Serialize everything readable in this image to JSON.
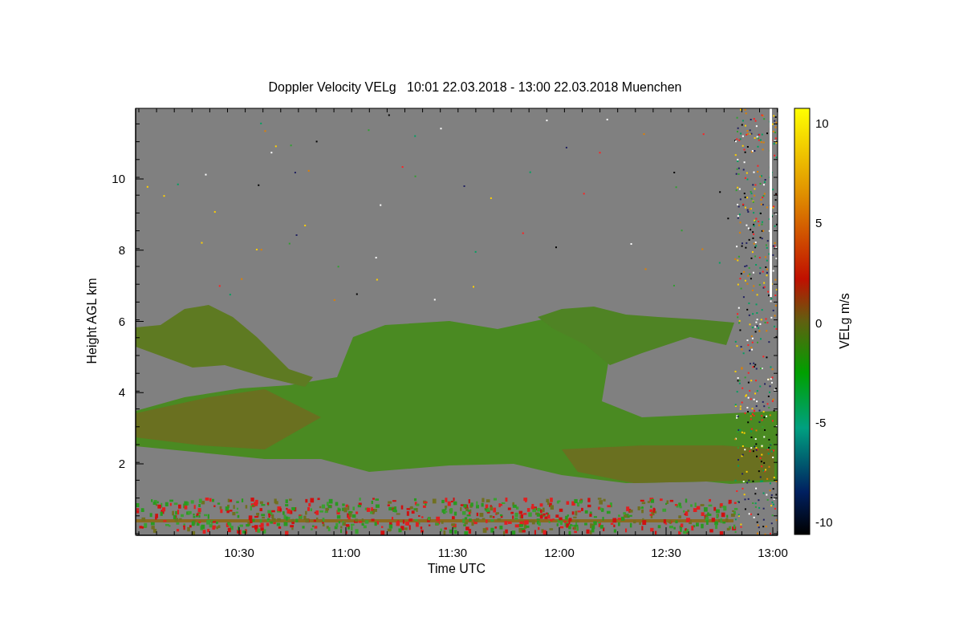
{
  "title": "Doppler Velocity VELg   10:01 22.03.2018 - 13:00 22.03.2018 Muenchen",
  "x_axis": {
    "label": "Time UTC",
    "ticks": [
      "10:30",
      "11:00",
      "11:30",
      "12:00",
      "12:30",
      "13:00"
    ]
  },
  "y_axis": {
    "label": "Height AGL km",
    "ticks": [
      "10",
      "8",
      "6",
      "4",
      "2"
    ]
  },
  "colorbar": {
    "label": "VELg m/s",
    "ticks": [
      "10",
      "5",
      "0",
      "-5",
      "-10"
    ]
  }
}
